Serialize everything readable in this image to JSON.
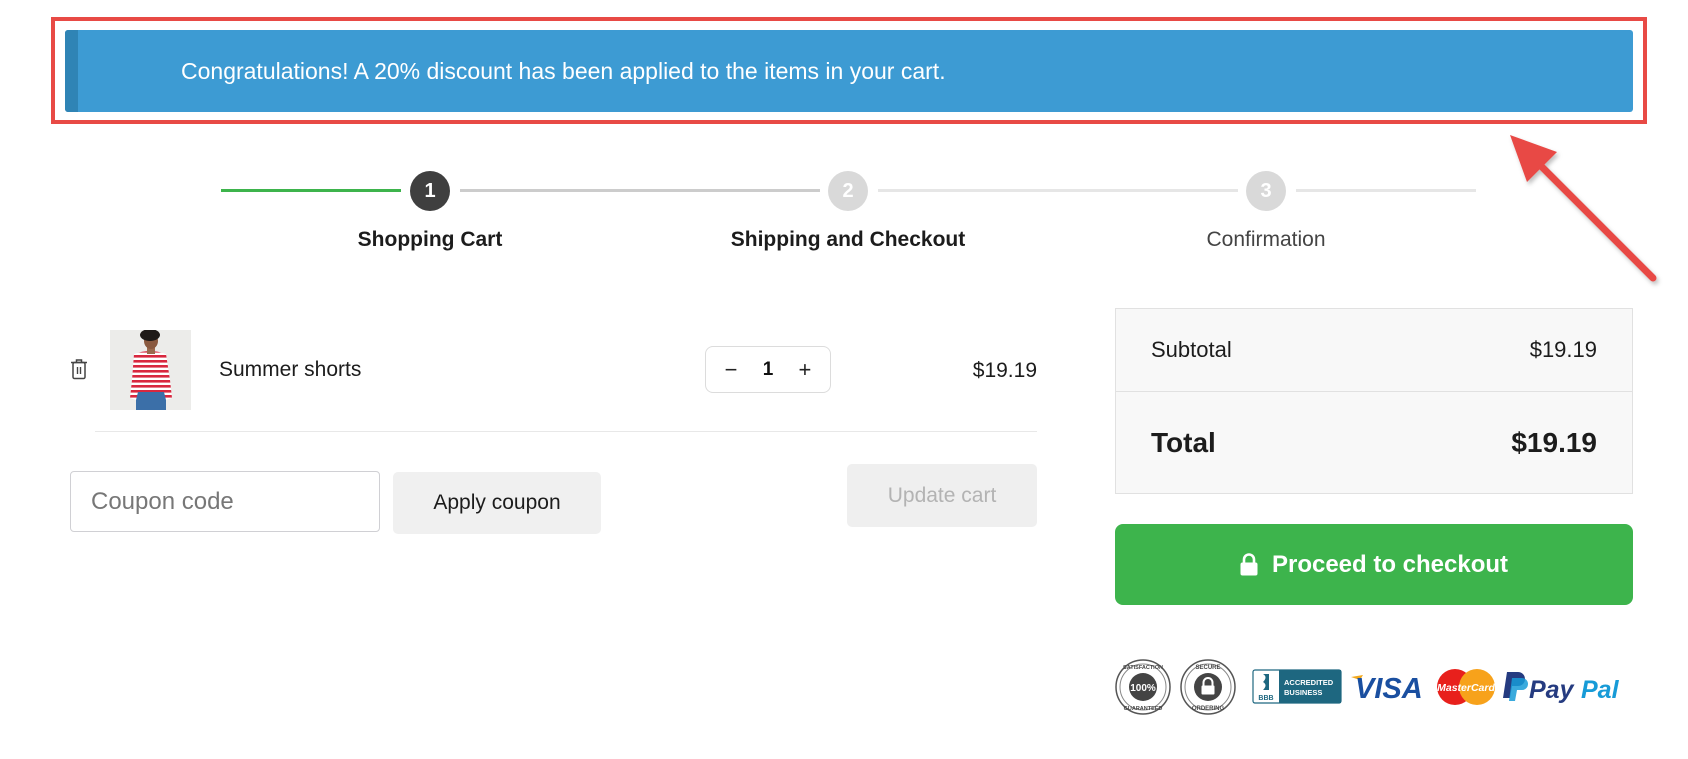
{
  "notice": {
    "message": "Congratulations! A 20% discount has been applied to the items in your cart."
  },
  "stepper": {
    "current_step": 1,
    "steps": [
      {
        "number": "1",
        "label": "Shopping Cart",
        "state": "active"
      },
      {
        "number": "2",
        "label": "Shipping and Checkout",
        "state": "upcoming"
      },
      {
        "number": "3",
        "label": "Confirmation",
        "state": "upcoming"
      }
    ]
  },
  "cart": {
    "items": [
      {
        "name": "Summer shorts",
        "quantity": "1",
        "price": "$19.19",
        "image_alt": "Woman in red and white striped top with denim"
      }
    ],
    "qty_decrement_label": "−",
    "qty_increment_label": "+",
    "coupon_placeholder": "Coupon code",
    "coupon_value": "",
    "apply_coupon_label": "Apply coupon",
    "update_cart_label": "Update cart"
  },
  "summary": {
    "subtotal_label": "Subtotal",
    "subtotal_value": "$19.19",
    "total_label": "Total",
    "total_value": "$19.19",
    "checkout_label": "Proceed to checkout"
  },
  "trust_badges": {
    "satisfaction_top": "SATISFACTION",
    "satisfaction_center": "100%",
    "satisfaction_bottom": "GUARANTEED",
    "secure_top": "SECURE",
    "secure_bottom": "ORDERING",
    "bbb_line1": "ACCREDITED",
    "bbb_line2": "BUSINESS",
    "bbb_mark": "BBB",
    "visa": "VISA",
    "mastercard": "MasterCard",
    "paypal_pay": "Pay",
    "paypal_pal": "Pal"
  },
  "colors": {
    "notice_bg": "#3d9bd3",
    "success_green": "#3db44c",
    "annotation_red": "#e84a45",
    "step_active": "#3f3f3f",
    "step_inactive": "#d9d9d9"
  }
}
